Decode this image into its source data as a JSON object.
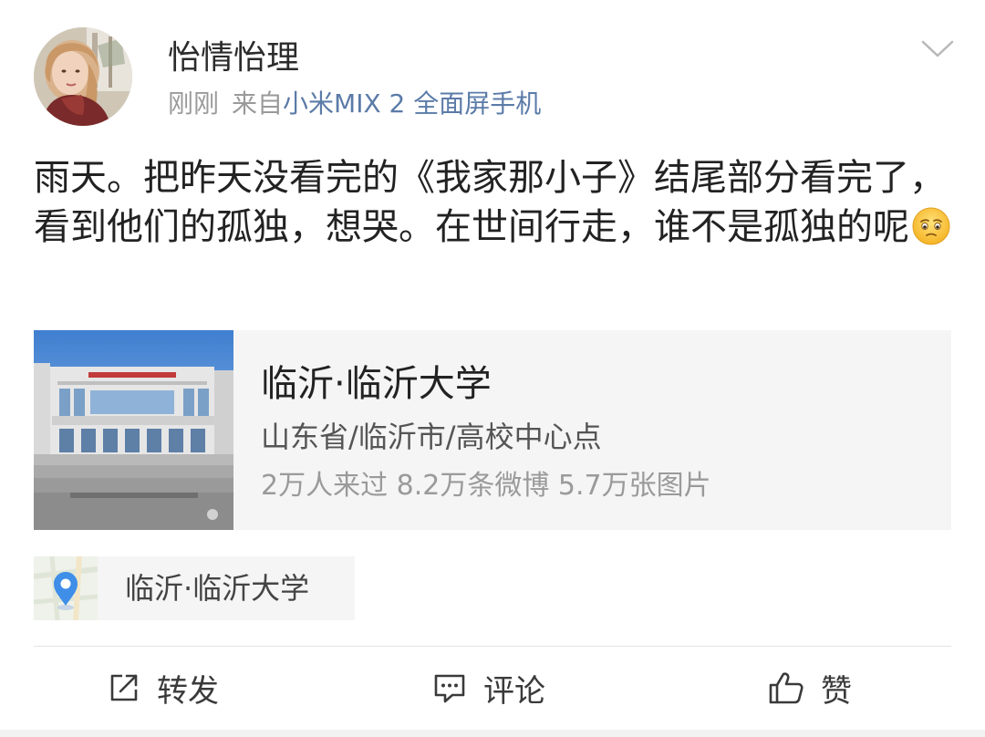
{
  "header": {
    "username": "怡情怡理",
    "time": "刚刚",
    "source_prefix": "来自",
    "source_device": "小米MIX 2 全面屏手机"
  },
  "post": {
    "text": "雨天。把昨天没看完的《我家那小子》结尾部分看完了，看到他们的孤独，想哭。在世间行走，谁不是孤独的呢",
    "emoji": "sad-face-emoji"
  },
  "location_card": {
    "title": "临沂·临沂大学",
    "region": "山东省/临沂市/高校中心点",
    "stats": "2万人来过 8.2万条微博 5.7万张图片"
  },
  "location_tag": {
    "label": "临沂·临沂大学",
    "icon": "map-pin-icon"
  },
  "actions": {
    "repost_label": "转发",
    "comment_label": "评论",
    "like_label": "赞"
  },
  "colors": {
    "source_link": "#5b7ba8",
    "muted_text": "#9a9a9a",
    "card_background": "#f5f5f5",
    "pin_blue": "#3f8ee8"
  }
}
